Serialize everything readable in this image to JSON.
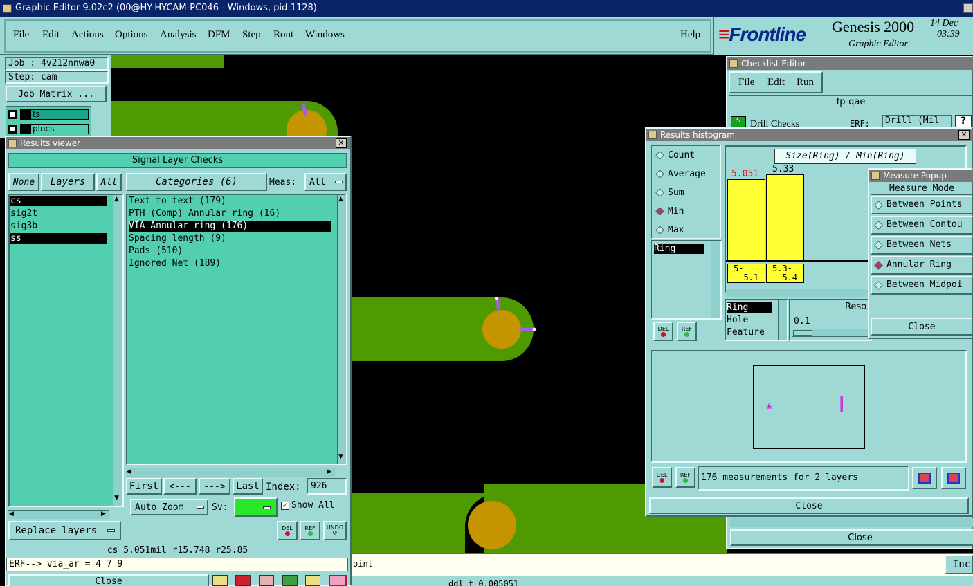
{
  "app": {
    "title": "Graphic Editor 9.02c2 (00@HY-HYCAM-PC046 - Windows, pid:1128)"
  },
  "menu": {
    "items": [
      "File",
      "Edit",
      "Actions",
      "Options",
      "Analysis",
      "DFM",
      "Step",
      "Rout",
      "Windows"
    ],
    "help": "Help"
  },
  "brand": {
    "logo": "Frontline",
    "product": "Genesis 2000",
    "subtitle": "Graphic Editor",
    "date": "14 Dec",
    "time": "03:39"
  },
  "job": {
    "job_label": "Job : 4v212nnwa0",
    "step_label": "Step: cam",
    "matrix_button": "Job Matrix ...",
    "layers": [
      {
        "name": "ts"
      },
      {
        "name": "plncs"
      }
    ]
  },
  "results_viewer": {
    "title": "Results viewer",
    "heading": "Signal Layer Checks",
    "none_btn": "None",
    "layers_btn": "Layers",
    "all_btn": "All",
    "categories_btn": "Categories (6)",
    "meas_label": "Meas:",
    "meas_value": "All",
    "layers": [
      {
        "name": "cs",
        "selected": true
      },
      {
        "name": "sig2t",
        "selected": false
      },
      {
        "name": "sig3b",
        "selected": false
      },
      {
        "name": "ss",
        "selected": true
      }
    ],
    "categories": [
      {
        "label": "Text to text (179)",
        "selected": false
      },
      {
        "label": "PTH (Comp) Annular ring (16)",
        "selected": false
      },
      {
        "label": "VIA Annular ring (176)",
        "selected": true
      },
      {
        "label": "Spacing length (9)",
        "selected": false
      },
      {
        "label": "Pads (510)",
        "selected": false
      },
      {
        "label": "Ignored Net (189)",
        "selected": false
      }
    ],
    "nav": {
      "first": "First",
      "prev": "<---",
      "next": "--->",
      "last": "Last",
      "index_label": "Index:",
      "index_value": "926"
    },
    "auto_zoom": "Auto Zoom",
    "sv_label": "Sv:",
    "show_all": "Show All",
    "replace_layers": "Replace layers",
    "del": "DEL",
    "ref": "REF",
    "undo": "UNDO",
    "status": "cs 5.051mil  r15.748  r25.85",
    "command": "ERF--> via_ar = 4 7 9",
    "close": "Close"
  },
  "checklist_editor": {
    "title": "Checklist Editor",
    "menu": [
      "File",
      "Edit",
      "Run"
    ],
    "name": "fp-qae",
    "row_label": "Drill Checks",
    "erf": "ERF:",
    "drill": "Drill (Mil",
    "close": "Close"
  },
  "histogram": {
    "title": "Results histogram",
    "modes": [
      {
        "label": "Count",
        "on": false
      },
      {
        "label": "Average",
        "on": false
      },
      {
        "label": "Sum",
        "on": false
      },
      {
        "label": "Min",
        "on": true
      },
      {
        "label": "Max",
        "on": false
      }
    ],
    "chart_title": "Size(Ring) / Min(Ring)",
    "bar_values": [
      "5.051",
      "5.33"
    ],
    "bins": [
      "5-\n  5.1",
      "5.3-\n  5.4"
    ],
    "list1": [
      "Ring"
    ],
    "list2": [
      "Ring",
      "Hole",
      "Feature"
    ],
    "res_label": "Reso",
    "res_value": "0.1",
    "measurements": "176 measurements for 2 layers",
    "del": "DEL",
    "ref": "REF",
    "close": "Close"
  },
  "measure_popup": {
    "title": "Measure Popup",
    "heading": "Measure Mode",
    "modes": [
      {
        "label": "Between Points",
        "on": false
      },
      {
        "label": "Between Contou",
        "on": false
      },
      {
        "label": "Between Nets",
        "on": false
      },
      {
        "label": "Annular Ring",
        "on": true
      },
      {
        "label": "Between Midpoi",
        "on": false
      }
    ],
    "close": "Close"
  },
  "bottom": {
    "hint": "oint",
    "incl": "Incl",
    "status": "ddl     t    0.005051"
  },
  "colors": {
    "panel": "#9ed9d6",
    "list": "#52cfae",
    "copper": "#4e9a00",
    "pad": "#c49500",
    "marker": "#a060e0",
    "highlight": "#ffff33"
  }
}
